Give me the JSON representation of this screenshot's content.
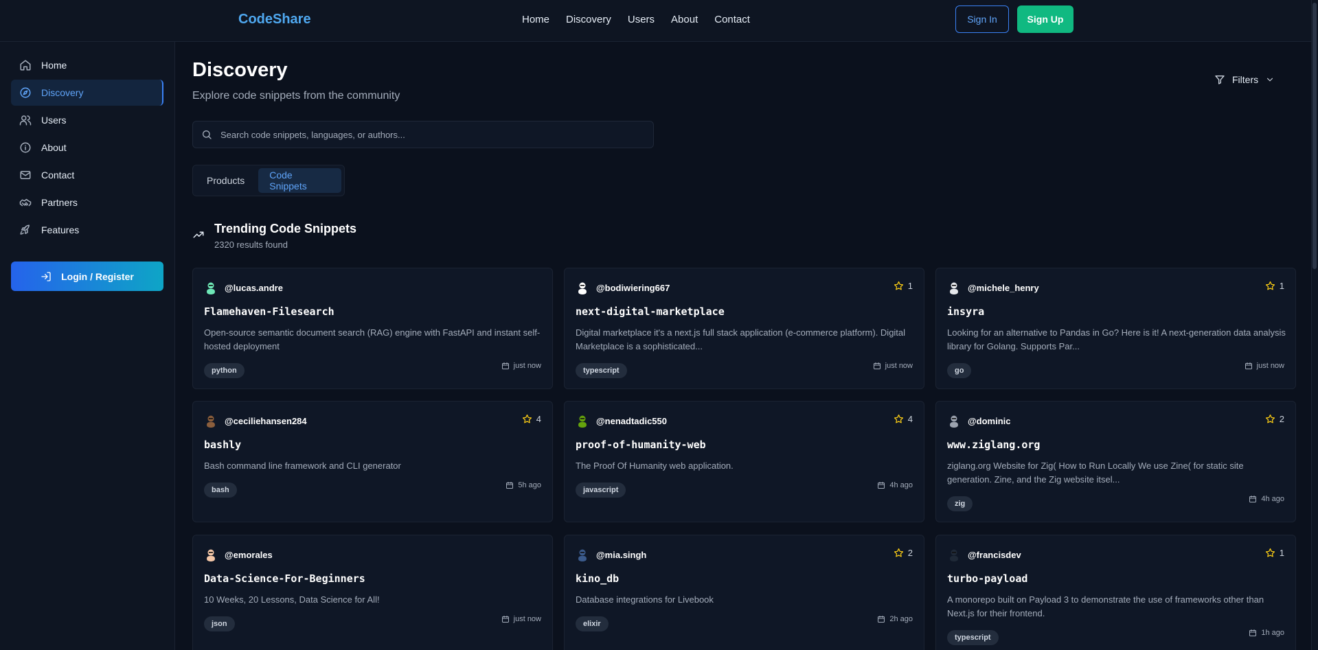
{
  "header": {
    "brand": "CodeShare",
    "nav": [
      "Home",
      "Discovery",
      "Users",
      "About",
      "Contact"
    ],
    "sign_in": "Sign In",
    "sign_up": "Sign Up"
  },
  "sidebar": {
    "items": [
      {
        "label": "Home",
        "icon": "home-icon"
      },
      {
        "label": "Discovery",
        "icon": "compass-icon",
        "active": true
      },
      {
        "label": "Users",
        "icon": "users-icon"
      },
      {
        "label": "About",
        "icon": "info-icon"
      },
      {
        "label": "Contact",
        "icon": "mail-icon"
      },
      {
        "label": "Partners",
        "icon": "handshake-icon"
      },
      {
        "label": "Features",
        "icon": "rocket-icon"
      }
    ],
    "login_label": "Login / Register"
  },
  "page": {
    "title": "Discovery",
    "subtitle": "Explore code snippets from the community",
    "filters_label": "Filters",
    "search_placeholder": "Search code snippets, languages, or authors...",
    "tabs": [
      {
        "label": "Products",
        "active": false
      },
      {
        "label": "Code Snippets",
        "active": true
      }
    ],
    "section_title": "Trending Code Snippets",
    "results_count": "2320 results found"
  },
  "cards": [
    {
      "author": "@lucas.andre",
      "stars": "",
      "title": "Flamehaven-Filesearch",
      "desc": "Open-source semantic document search (RAG) engine with FastAPI and instant self-hosted deployment",
      "tag": "python",
      "time": "just now",
      "avatar_color": "#6ee7b7"
    },
    {
      "author": "@bodiwiering667",
      "stars": "1",
      "title": "next-digital-marketplace",
      "desc": "Digital marketplace it's a next.js full stack application (e-commerce platform). Digital Marketplace is a sophisticated...",
      "tag": "typescript",
      "time": "just now",
      "avatar_color": "#ffffff"
    },
    {
      "author": "@michele_henry",
      "stars": "1",
      "title": "insyra",
      "desc": "Looking for an alternative to Pandas in Go? Here is it! A next-generation data analysis library for Golang. Supports Par...",
      "tag": "go",
      "time": "just now",
      "avatar_color": "#e5e7eb"
    },
    {
      "author": "@ceciliehansen284",
      "stars": "4",
      "title": "bashly",
      "desc": "Bash command line framework and CLI generator",
      "tag": "bash",
      "time": "5h ago",
      "avatar_color": "#8b5e3c"
    },
    {
      "author": "@nenadtadic550",
      "stars": "4",
      "title": "proof-of-humanity-web",
      "desc": "The Proof Of Humanity web application.",
      "tag": "javascript",
      "time": "4h ago",
      "avatar_color": "#65a30d"
    },
    {
      "author": "@dominic",
      "stars": "2",
      "title": "www.ziglang.org",
      "desc": "ziglang.org Website for Zig( How to Run Locally We use Zine( for static site generation. Zine, and the Zig website itsel...",
      "tag": "zig",
      "time": "4h ago",
      "avatar_color": "#9ca3af"
    },
    {
      "author": "@emorales",
      "stars": "",
      "title": "Data-Science-For-Beginners",
      "desc": "10 Weeks, 20 Lessons, Data Science for All!",
      "tag": "json",
      "time": "just now",
      "avatar_color": "#f4c7a8"
    },
    {
      "author": "@mia.singh",
      "stars": "2",
      "title": "kino_db",
      "desc": "Database integrations for Livebook",
      "tag": "elixir",
      "time": "2h ago",
      "avatar_color": "#3b5b8c"
    },
    {
      "author": "@francisdev",
      "stars": "1",
      "title": "turbo-payload",
      "desc": "A monorepo built on Payload 3 to demonstrate the use of frameworks other than Next.js for their frontend.",
      "tag": "typescript",
      "time": "1h ago",
      "avatar_color": "#1f2937"
    }
  ],
  "colors": {
    "accent": "#3b82f6",
    "success": "#10b981",
    "star": "#facc15",
    "brand": "#4fa8f0"
  }
}
